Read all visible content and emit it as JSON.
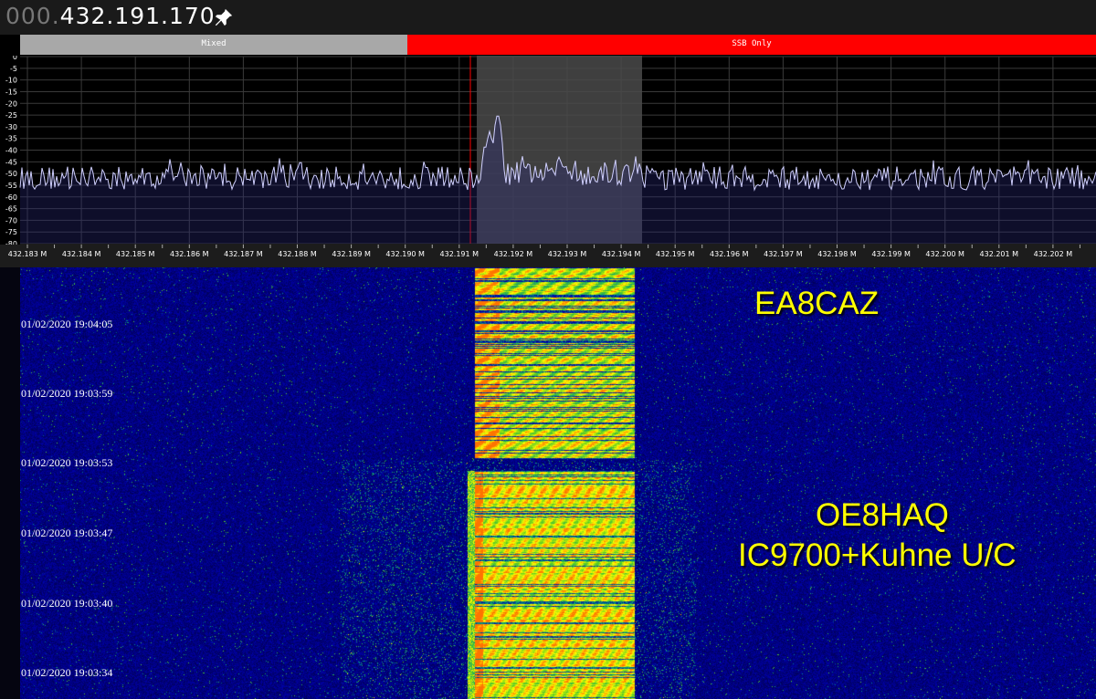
{
  "frequency": {
    "lead": "000.",
    "main": "432.191.170"
  },
  "toolbar": {
    "pin_icon": "pin-icon"
  },
  "bandplan": {
    "segments": [
      {
        "label": "Mixed",
        "color": "#a8a8a8"
      },
      {
        "label": "SSB Only",
        "color": "#ff0000"
      }
    ]
  },
  "spectrum": {
    "y_ticks": [
      "0",
      "-5",
      "-10",
      "-15",
      "-20",
      "-25",
      "-30",
      "-35",
      "-40",
      "-45",
      "-50",
      "-55",
      "-60",
      "-65",
      "-70",
      "-75",
      "-80"
    ],
    "x_ticks": [
      "432.183 M",
      "432.184 M",
      "432.185 M",
      "432.186 M",
      "432.187 M",
      "432.188 M",
      "432.189 M",
      "432.190 M",
      "432.191 M",
      "432.192 M",
      "432.193 M",
      "432.194 M",
      "432.195 M",
      "432.196 M",
      "432.197 M",
      "432.198 M",
      "432.199 M",
      "432.200 M",
      "432.201 M",
      "432.202 M"
    ],
    "marker_color": "#ff0000",
    "passband_color": "#4a4a4a",
    "trace_color": "#d0d0ff"
  },
  "waterfall": {
    "timestamps": [
      "01/02/2020 19:04:05",
      "01/02/2020 19:03:59",
      "01/02/2020 19:03:53",
      "01/02/2020 19:03:47",
      "01/02/2020 19:03:40",
      "01/02/2020 19:03:34"
    ],
    "labels": {
      "station1": "EA8CAZ",
      "station2_line1": "OE8HAQ",
      "station2_line2": "IC9700+Kuhne U/C"
    },
    "label_color": "#ffff00"
  }
}
